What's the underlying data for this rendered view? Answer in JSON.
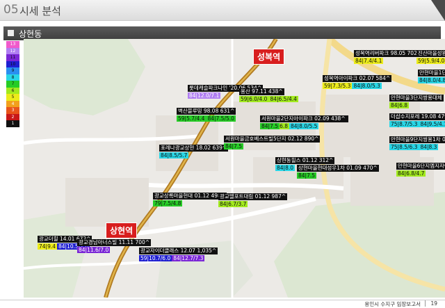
{
  "header": {
    "section_number": "05",
    "title": "시세 분석"
  },
  "subheader": {
    "title": "상현동"
  },
  "legend": {
    "levels": [
      {
        "label": "13",
        "color": "#f05acb"
      },
      {
        "label": "12",
        "color": "#b07ef2"
      },
      {
        "label": "11",
        "color": "#7a26d6"
      },
      {
        "label": "10",
        "color": "#1f1fd1"
      },
      {
        "label": "9",
        "color": "#2a8ff0"
      },
      {
        "label": "8",
        "color": "#28d6e6"
      },
      {
        "label": "7",
        "color": "#26cc26"
      },
      {
        "label": "6",
        "color": "#a2ea1e"
      },
      {
        "label": "5",
        "color": "#ecec1a"
      },
      {
        "label": "4",
        "color": "#f2a01c"
      },
      {
        "label": "3",
        "color": "#e8541a"
      },
      {
        "label": "2",
        "color": "#c81818"
      },
      {
        "label": "1",
        "color": "#111111"
      }
    ]
  },
  "stations": {
    "seongbok": "성복역",
    "sanghyeon": "상현역"
  },
  "labels": [
    {
      "id": "l1",
      "title": "성복역리버파크 98.05 702^",
      "prices": [
        [
          "84|7.4/4.1",
          "#ecec1a"
        ]
      ]
    },
    {
      "id": "l2",
      "title": "진산마을성원",
      "prices": [
        [
          "59|5.9/4.0",
          "#ecec1a"
        ],
        [
          "84|7.2/4.9",
          "#ecec1a"
        ]
      ]
    },
    {
      "id": "l3",
      "title": "만현마을1단지로대체을 02",
      "prices": [
        [
          "84|8.0/4.8",
          "#28d6e6"
        ]
      ]
    },
    {
      "id": "l4",
      "title": "성복역아이파크 02.07 584^",
      "prices": [
        [
          "59|7.3/5.3",
          "#ecec1a"
        ],
        [
          "84|8.0/5.3",
          "#28d6e6"
        ]
      ]
    },
    {
      "id": "l5",
      "title": "롯데캐슬파크나인 '20.06 534^",
      "prices": [
        [
          "84|12.0/7.1",
          "#b07ef2"
        ]
      ]
    },
    {
      "id": "l6",
      "title": "용산 97.11 438^",
      "prices": [
        [
          "59|6.0/4.0",
          "#a2ea1e"
        ],
        [
          "84|6.5/4.4",
          "#a2ea1e"
        ]
      ]
    },
    {
      "id": "l7",
      "title": "서원마을현대홈타운 01.02 462^",
      "prices": [
        [
          "59|6.8",
          "#a2ea1e"
        ],
        [
          "84|8.0/5.5",
          "#28d6e6"
        ]
      ]
    },
    {
      "id": "l8",
      "title": "만현마을3단지쌍용대체",
      "prices": [
        [
          "84|6.8",
          "#a2ea1e"
        ]
      ]
    },
    {
      "id": "l9",
      "title": "벽산블루밍 98.08 631^",
      "prices": [
        [
          "59|5.7/4.4",
          "#26cc26"
        ],
        [
          "84|7.5/5.0",
          "#26cc26"
        ]
      ]
    },
    {
      "id": "l10",
      "title": "서원마을2단지아이파크 02.09 438^",
      "prices": [
        [
          "84|7.5",
          "#26cc26"
        ]
      ]
    },
    {
      "id": "l11",
      "title": "더샵수지포레 19.08 479^",
      "prices": [
        [
          "75|8.7/5.3",
          "#28d6e6"
        ],
        [
          "84|9.5/4.7",
          "#28d6e6"
        ]
      ]
    },
    {
      "id": "l12",
      "title": "포레나광교상현 18.02 639^",
      "prices": [
        [
          "84|8.5/5.7",
          "#28d6e6"
        ]
      ]
    },
    {
      "id": "l13",
      "title": "서원마을금호베스트빌5단지 02.12 890^",
      "prices": [
        [
          "84|7.5",
          "#26cc26"
        ]
      ]
    },
    {
      "id": "l14",
      "title": "만현마을9단지쌍용1차 01.06 992^",
      "prices": [
        [
          "75|8.5/6.3",
          "#28d6e6"
        ],
        [
          "84|8.3",
          "#28d6e6"
        ]
      ]
    },
    {
      "id": "l15",
      "title": "상현동힐스 01.12 312^",
      "prices": [
        [
          "84|8.0",
          "#28d6e6"
        ]
      ]
    },
    {
      "id": "l16",
      "title": "상현마을현대성우1차 01.09 470^",
      "prices": [
        [
          "84|7.5",
          "#26cc26"
        ]
      ]
    },
    {
      "id": "l17",
      "title": "만현마을6단지엠지자이",
      "prices": [
        [
          "84|6.8/4.7",
          "#a2ea1e"
        ]
      ]
    },
    {
      "id": "l18",
      "title": "광교상록마을현대 01.12 498^",
      "prices": [
        [
          "79|7.5/4.8",
          "#26cc26"
        ]
      ]
    },
    {
      "id": "l19",
      "title": "광교엘포트대림 01.12 987^",
      "prices": [
        [
          "84|6.7/3.7",
          "#a2ea1e"
        ]
      ]
    },
    {
      "id": "l20",
      "title": "광교더힐 14.01 672^",
      "prices": [
        [
          "74|9.4",
          "#ecec1a"
        ],
        [
          "84|10.5/7.0",
          "#1f1fd1"
        ]
      ]
    },
    {
      "id": "l21",
      "title": "광교경남아너스빌 11.11 700^",
      "prices": [
        [
          "84|11.6/7.0",
          "#7a26d6"
        ]
      ]
    },
    {
      "id": "l22",
      "title": "광교자이더클래스 12.07 1,035^",
      "prices": [
        [
          "59|10.7/6.0",
          "#1f1fd1"
        ],
        [
          "84|12.7/7.3",
          "#7a26d6"
        ]
      ]
    }
  ],
  "footer": {
    "report": "용인시 수지구 임장보고서",
    "page": "19"
  }
}
